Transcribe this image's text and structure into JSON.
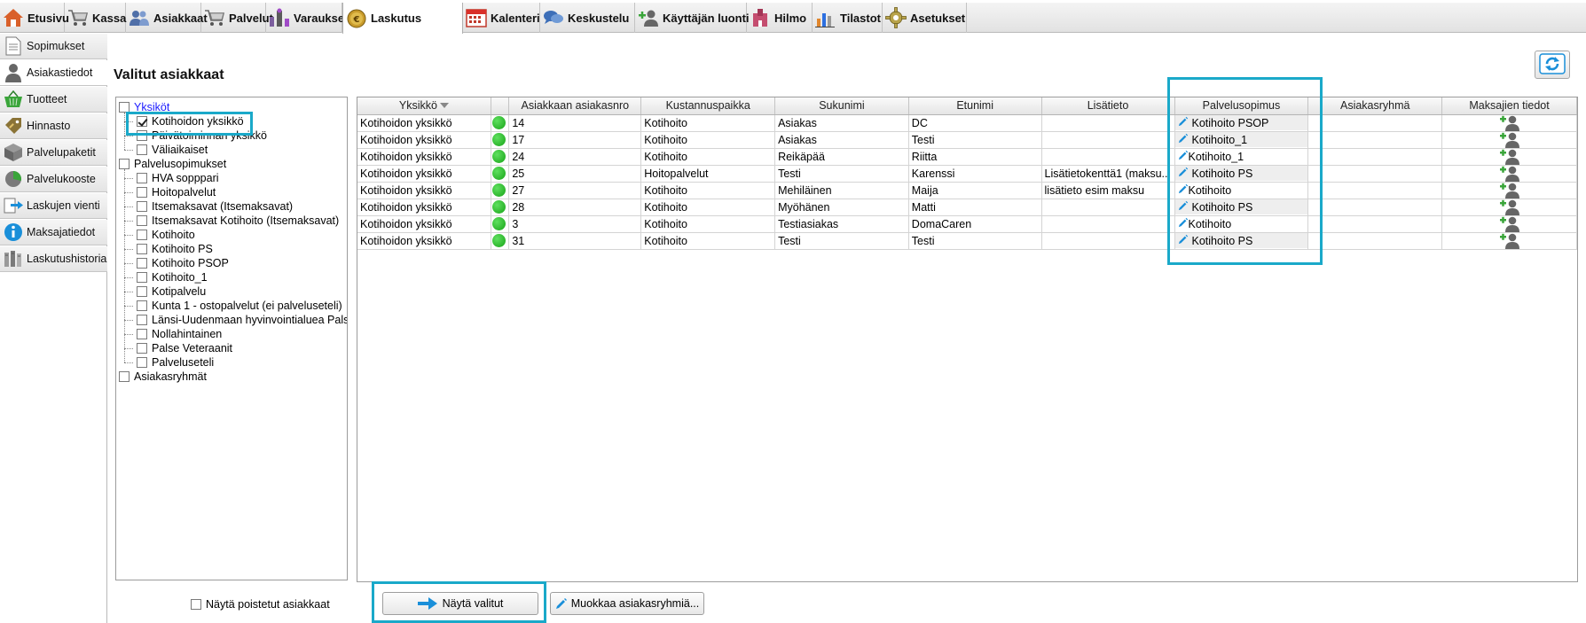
{
  "topnav": [
    {
      "label": "Etusivu",
      "icon": "home-icon"
    },
    {
      "label": "Kassa",
      "icon": "cart-icon"
    },
    {
      "label": "Asiakkaat",
      "icon": "users-icon"
    },
    {
      "label": "Palvelut",
      "icon": "cart-icon"
    },
    {
      "label": "Varaukset",
      "icon": "booking-icon"
    },
    {
      "label": "Laskutus",
      "icon": "euro-coin-icon"
    },
    {
      "label": "Kalenteri",
      "icon": "calendar-icon"
    },
    {
      "label": "Keskustelu",
      "icon": "chat-icon"
    },
    {
      "label": "Käyttäjän luonti",
      "icon": "add-user-icon"
    },
    {
      "label": "Hilmo",
      "icon": "building-icon"
    },
    {
      "label": "Tilastot",
      "icon": "bar-chart-icon"
    },
    {
      "label": "Asetukset",
      "icon": "gear-icon"
    }
  ],
  "sidenav": [
    {
      "label": "Sopimukset",
      "icon": "document-icon"
    },
    {
      "label": "Asiakastiedot",
      "icon": "person-icon"
    },
    {
      "label": "Tuotteet",
      "icon": "basket-icon"
    },
    {
      "label": "Hinnasto",
      "icon": "price-tag-icon"
    },
    {
      "label": "Palvelupaketit",
      "icon": "package-icon"
    },
    {
      "label": "Palvelukooste",
      "icon": "pie-chart-icon"
    },
    {
      "label": "Laskujen vienti",
      "icon": "export-icon"
    },
    {
      "label": "Maksajatiedot",
      "icon": "info-icon"
    },
    {
      "label": "Laskutushistoria",
      "icon": "archive-icon"
    }
  ],
  "page": {
    "title": "Valitut asiakkaat"
  },
  "tree": {
    "groups": [
      {
        "label": "Yksiköt",
        "link": true,
        "children": [
          {
            "label": "Kotihoidon yksikkö",
            "checked": true
          },
          {
            "label": "Päivätoiminnan yksikkö",
            "checked": false
          },
          {
            "label": "Väliaikaiset",
            "checked": false
          }
        ]
      },
      {
        "label": "Palvelusopimukset",
        "link": false,
        "children": [
          {
            "label": "HVA  sopppari",
            "checked": false
          },
          {
            "label": "Hoitopalvelut",
            "checked": false
          },
          {
            "label": "Itsemaksavat (Itsemaksavat)",
            "checked": false
          },
          {
            "label": "Itsemaksavat Kotihoito (Itsemaksavat)",
            "checked": false
          },
          {
            "label": "Kotihoito",
            "checked": false
          },
          {
            "label": "Kotihoito PS",
            "checked": false
          },
          {
            "label": "Kotihoito PSOP",
            "checked": false
          },
          {
            "label": "Kotihoito_1",
            "checked": false
          },
          {
            "label": "Kotipalvelu",
            "checked": false
          },
          {
            "label": "Kunta 1 - ostopalvelut (ei palveluseteli)",
            "checked": false
          },
          {
            "label": "Länsi-Uudenmaan hyvinvointialuea Palse",
            "checked": false
          },
          {
            "label": "Nollahintainen",
            "checked": false
          },
          {
            "label": "Palse Veteraanit",
            "checked": false
          },
          {
            "label": "Palveluseteli",
            "checked": false
          }
        ]
      },
      {
        "label": "Asiakasryhmät",
        "link": false,
        "children": []
      }
    ]
  },
  "grid": {
    "columns": [
      "Yksikkö",
      "",
      "Asiakkaan asiakasnro",
      "Kustannuspaikka",
      "Sukunimi",
      "Etunimi",
      "Lisätieto",
      "Palvelusopimus",
      "Asiakasryhmä",
      "Maksajien tiedot"
    ],
    "rows": [
      {
        "yksikko": "Kotihoidon yksikkö",
        "status": "green",
        "nro": "14",
        "kustannuspaikka": "Kotihoito",
        "sukunimi": "Asiakas",
        "etunimi": "DC",
        "lisatieto": "",
        "palvelusopimus": "Kotihoito PSOP",
        "shaded": true,
        "asiakasryhma": ""
      },
      {
        "yksikko": "Kotihoidon yksikkö",
        "status": "green",
        "nro": "17",
        "kustannuspaikka": "Kotihoito",
        "sukunimi": "Asiakas",
        "etunimi": "Testi",
        "lisatieto": "",
        "palvelusopimus": "Kotihoito_1",
        "shaded": true,
        "asiakasryhma": ""
      },
      {
        "yksikko": "Kotihoidon yksikkö",
        "status": "green",
        "nro": "24",
        "kustannuspaikka": "Kotihoito",
        "sukunimi": "Reikäpää",
        "etunimi": "Riitta",
        "lisatieto": "",
        "palvelusopimus": "Kotihoito_1",
        "shaded": false,
        "asiakasryhma": ""
      },
      {
        "yksikko": "Kotihoidon yksikkö",
        "status": "green",
        "nro": "25",
        "kustannuspaikka": "Hoitopalvelut",
        "sukunimi": "Testi",
        "etunimi": "Karenssi",
        "lisatieto": "Lisätietokenttä1 (maksu...",
        "palvelusopimus": "Kotihoito PS",
        "shaded": true,
        "asiakasryhma": ""
      },
      {
        "yksikko": "Kotihoidon yksikkö",
        "status": "green",
        "nro": "27",
        "kustannuspaikka": "Kotihoito",
        "sukunimi": "Mehiläinen",
        "etunimi": "Maija",
        "lisatieto": "lisätieto esim maksu",
        "palvelusopimus": "Kotihoito",
        "shaded": false,
        "asiakasryhma": ""
      },
      {
        "yksikko": "Kotihoidon yksikkö",
        "status": "green",
        "nro": "28",
        "kustannuspaikka": "Kotihoito",
        "sukunimi": "Myöhänen",
        "etunimi": "Matti",
        "lisatieto": "",
        "palvelusopimus": "Kotihoito PS",
        "shaded": true,
        "asiakasryhma": ""
      },
      {
        "yksikko": "Kotihoidon yksikkö",
        "status": "green",
        "nro": "3",
        "kustannuspaikka": "Kotihoito",
        "sukunimi": "Testiasiakas",
        "etunimi": "DomaCaren",
        "lisatieto": "",
        "palvelusopimus": "Kotihoito",
        "shaded": false,
        "asiakasryhma": ""
      },
      {
        "yksikko": "Kotihoidon yksikkö",
        "status": "green",
        "nro": "31",
        "kustannuspaikka": "Kotihoito",
        "sukunimi": "Testi",
        "etunimi": "Testi",
        "lisatieto": "",
        "palvelusopimus": "Kotihoito PS",
        "shaded": true,
        "asiakasryhma": ""
      }
    ]
  },
  "bottom": {
    "show_deleted_label": "Näytä poistetut asiakkaat",
    "show_selected_button": "Näytä valitut",
    "edit_groups_button": "Muokkaa asiakasryhmiä..."
  },
  "colors": {
    "highlight": "#1aa9c9",
    "status_green": "#1bb01b",
    "link": "#1a1aff",
    "accent_blue": "#1a8fd9"
  }
}
